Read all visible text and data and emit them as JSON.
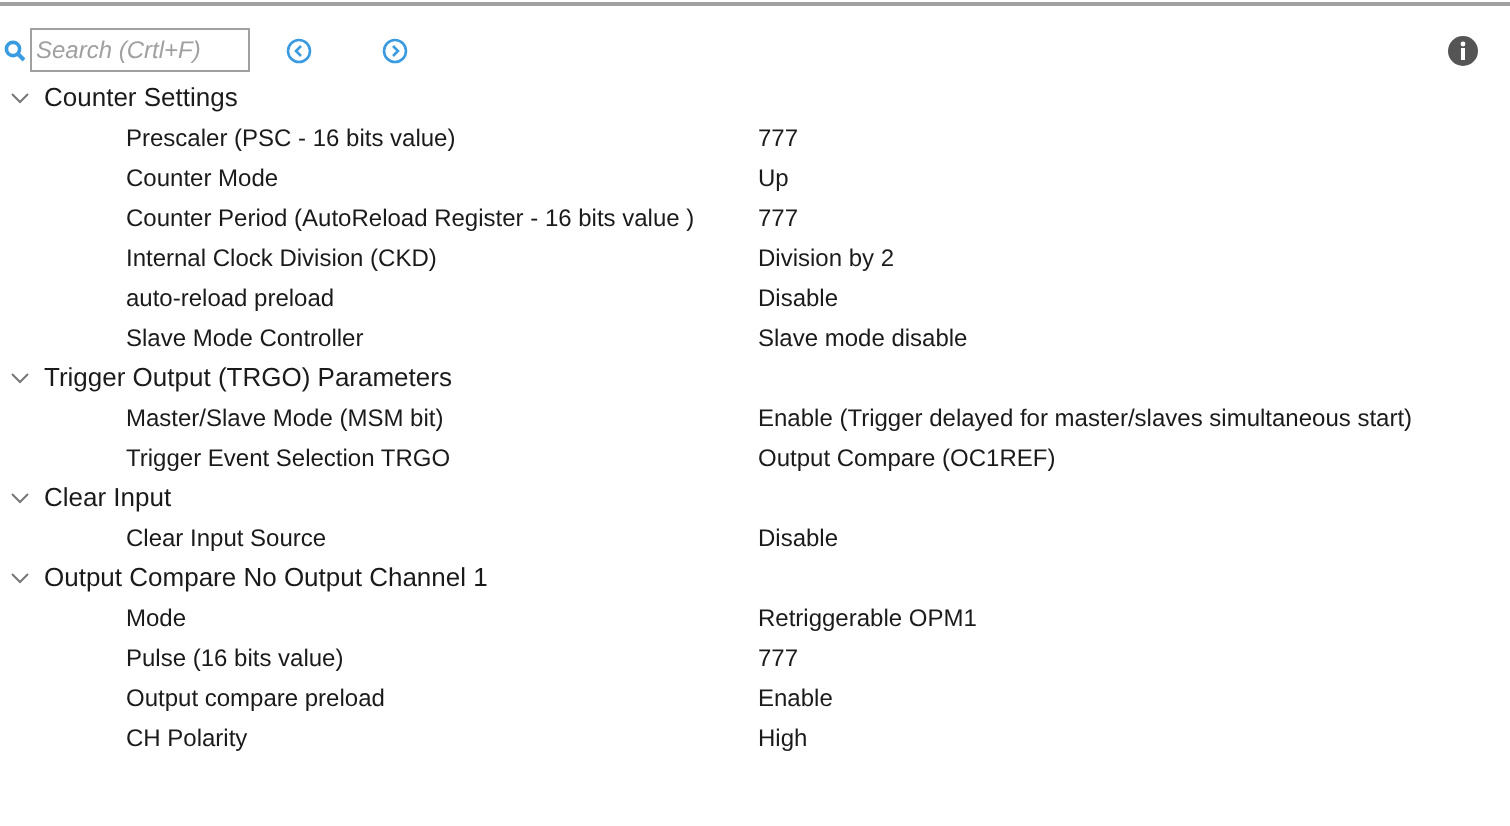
{
  "search": {
    "placeholder": "Search (Crtl+F)"
  },
  "groups": [
    {
      "title": "Counter Settings",
      "expanded": true,
      "params": [
        {
          "name": "Prescaler (PSC - 16 bits value)",
          "value": "777"
        },
        {
          "name": "Counter Mode",
          "value": "Up"
        },
        {
          "name": "Counter Period (AutoReload Register - 16 bits value )",
          "value": "777"
        },
        {
          "name": "Internal Clock Division (CKD)",
          "value": "Division by 2"
        },
        {
          "name": "auto-reload preload",
          "value": "Disable"
        },
        {
          "name": "Slave Mode Controller",
          "value": "Slave mode disable"
        }
      ]
    },
    {
      "title": "Trigger Output (TRGO) Parameters",
      "expanded": true,
      "params": [
        {
          "name": "Master/Slave Mode (MSM bit)",
          "value": "Enable (Trigger delayed for master/slaves simultaneous start)"
        },
        {
          "name": "Trigger Event Selection TRGO",
          "value": "Output Compare (OC1REF)"
        }
      ]
    },
    {
      "title": "Clear Input",
      "expanded": true,
      "params": [
        {
          "name": "Clear Input Source",
          "value": "Disable"
        }
      ]
    },
    {
      "title": "Output Compare No Output Channel 1",
      "expanded": true,
      "params": [
        {
          "name": "Mode",
          "value": "Retriggerable OPM1"
        },
        {
          "name": "Pulse (16 bits value)",
          "value": "777"
        },
        {
          "name": "Output compare preload",
          "value": "Enable"
        },
        {
          "name": "CH Polarity",
          "value": "High"
        }
      ]
    }
  ]
}
